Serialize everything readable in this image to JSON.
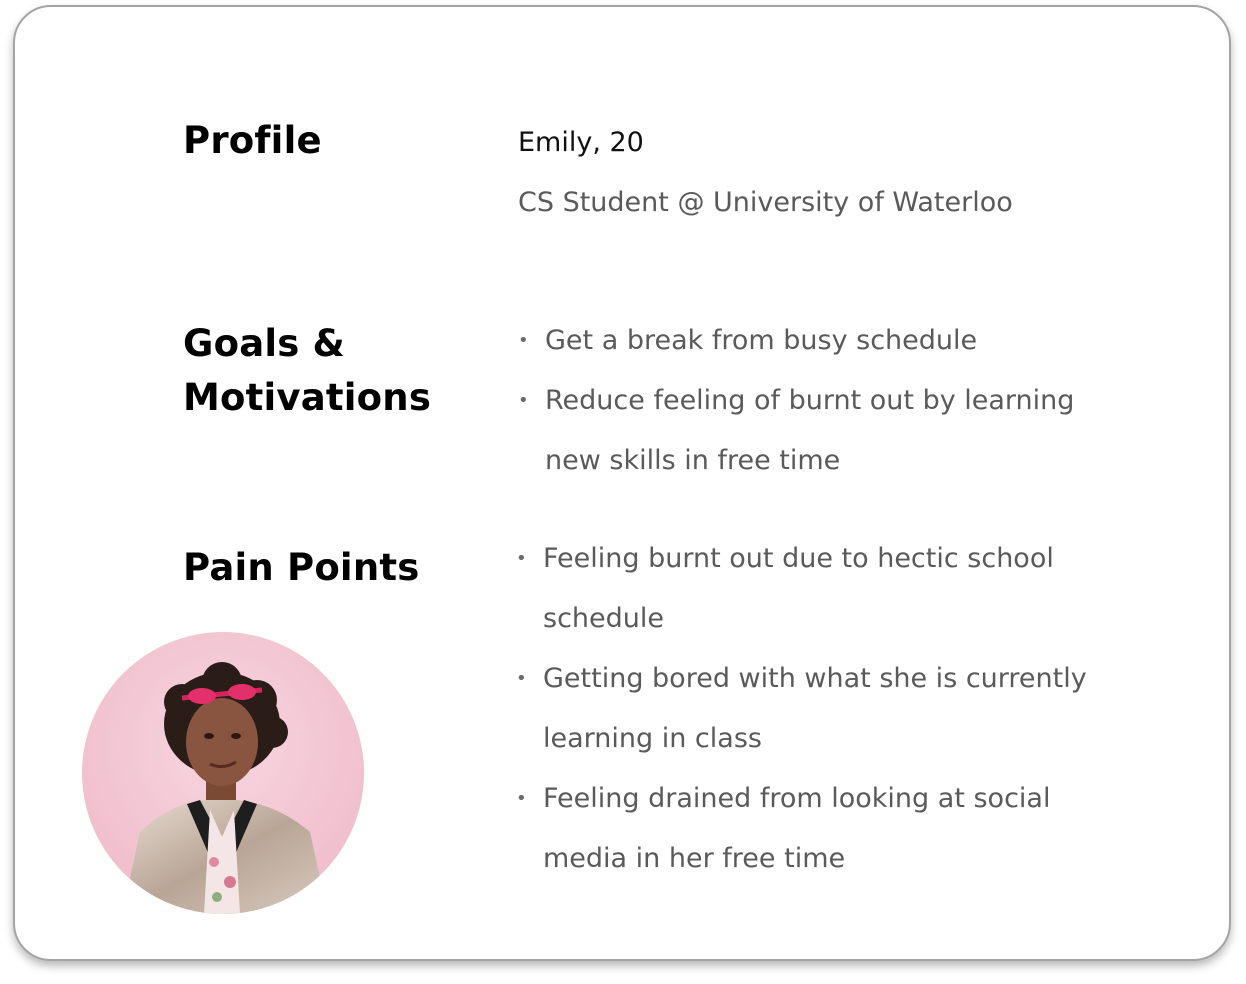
{
  "profile": {
    "heading": "Profile",
    "name_age": "Emily, 20",
    "role": "CS Student @ University of Waterloo"
  },
  "goals": {
    "heading": "Goals & Motivations",
    "items": [
      {
        "text": "Get a break from busy schedule"
      },
      {
        "text": "Reduce feeling of burnt out by learning new skills in free time"
      }
    ]
  },
  "pain_points": {
    "heading": "Pain Points",
    "items": [
      {
        "text": "Feeling burnt out due to hectic school schedule"
      },
      {
        "text": "Getting bored with what she is currently learning in class"
      },
      {
        "text": "Feeling drained from looking at social media in her free time"
      }
    ]
  },
  "bullet_symbol": "•",
  "colors": {
    "heading": "#000000",
    "body_text": "#5a5a5a",
    "card_border": "#a4a4a4",
    "avatar_background": "#f2c6d3"
  }
}
